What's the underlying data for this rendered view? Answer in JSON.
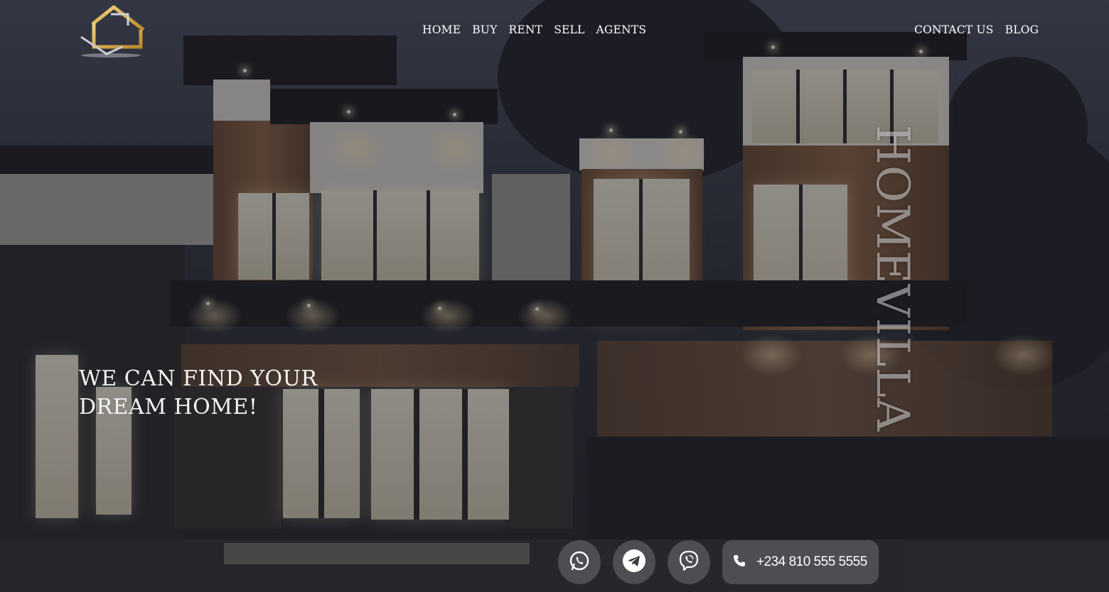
{
  "brand": {
    "logo_icon": "house-logo-icon",
    "vertical_text": "HOMEVILLA"
  },
  "nav": {
    "main": [
      {
        "label": "HOME"
      },
      {
        "label": "BUY"
      },
      {
        "label": "RENT"
      },
      {
        "label": "SELL"
      },
      {
        "label": "AGENTS"
      }
    ],
    "side": [
      {
        "label": "CONTACT US"
      },
      {
        "label": "BLOG"
      }
    ]
  },
  "hero": {
    "title_line1": "WE CAN FIND YOUR",
    "title_line2": "DREAM HOME!"
  },
  "contact": {
    "icons": [
      "whatsapp-icon",
      "telegram-icon",
      "viber-icon",
      "phone-icon"
    ],
    "phone": "+234 810 555 5555"
  },
  "colors": {
    "logo_gold": "#e2b64a",
    "logo_silver": "#c9ccd2",
    "text": "#ffffff"
  }
}
